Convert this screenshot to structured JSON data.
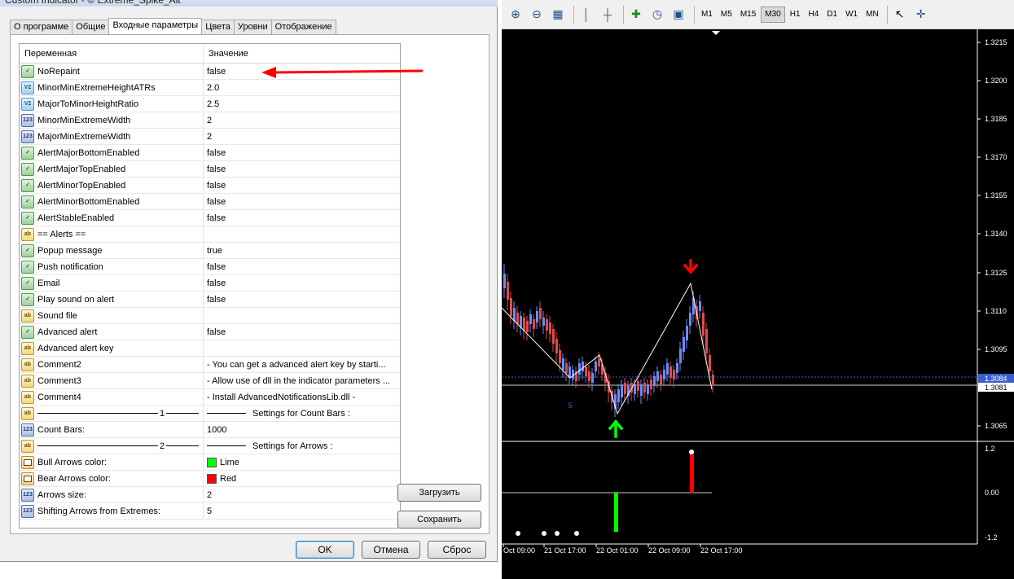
{
  "window": {
    "title": "Custom Indicator - © Extreme_Spike_Alt"
  },
  "tabs": [
    "О программе",
    "Общие",
    "Входные параметры",
    "Цвета",
    "Уровни",
    "Отображение"
  ],
  "grid": {
    "headers": {
      "variable": "Переменная",
      "value": "Значение"
    },
    "rows": [
      {
        "type": "bool",
        "icon": "bool-icon",
        "name": "NoRepaint",
        "value": "false"
      },
      {
        "type": "dbl",
        "icon": "double-icon",
        "name": "MinorMinExtremeHeightATRs",
        "value": "2.0"
      },
      {
        "type": "dbl",
        "icon": "double-icon",
        "name": "MajorToMinorHeightRatio",
        "value": "2.5"
      },
      {
        "type": "int",
        "icon": "integer-icon",
        "name": "MinorMinExtremeWidth",
        "value": "2"
      },
      {
        "type": "int",
        "icon": "integer-icon",
        "name": "MajorMinExtremeWidth",
        "value": "2"
      },
      {
        "type": "bool",
        "icon": "bool-icon",
        "name": "AlertMajorBottomEnabled",
        "value": "false"
      },
      {
        "type": "bool",
        "icon": "bool-icon",
        "name": "AlertMajorTopEnabled",
        "value": "false"
      },
      {
        "type": "bool",
        "icon": "bool-icon",
        "name": "AlertMinorTopEnabled",
        "value": "false"
      },
      {
        "type": "bool",
        "icon": "bool-icon",
        "name": "AlertMinorBottomEnabled",
        "value": "false"
      },
      {
        "type": "bool",
        "icon": "bool-icon",
        "name": "AlertStableEnabled",
        "value": "false"
      },
      {
        "type": "str",
        "icon": "string-icon",
        "name": "== Alerts ==",
        "value": ""
      },
      {
        "type": "bool",
        "icon": "bool-icon",
        "name": "Popup message",
        "value": "true"
      },
      {
        "type": "bool",
        "icon": "bool-icon",
        "name": "Push notification",
        "value": "false"
      },
      {
        "type": "bool",
        "icon": "bool-icon",
        "name": "Email",
        "value": "false"
      },
      {
        "type": "bool",
        "icon": "bool-icon",
        "name": "Play sound on alert",
        "value": "false"
      },
      {
        "type": "str",
        "icon": "string-icon",
        "name": "Sound file",
        "value": ""
      },
      {
        "type": "bool",
        "icon": "bool-icon",
        "name": "Advanced alert",
        "value": "false"
      },
      {
        "type": "str",
        "icon": "string-icon",
        "name": "Advanced alert key",
        "value": ""
      },
      {
        "type": "str",
        "icon": "string-icon",
        "name": "Comment2",
        "value": "- You can get a advanced alert key by starti..."
      },
      {
        "type": "str",
        "icon": "string-icon",
        "name": "Comment3",
        "value": "- Allow use of dll in the indicator parameters ..."
      },
      {
        "type": "str",
        "icon": "string-icon",
        "name": "Comment4",
        "value": "- Install AdvancedNotificationsLib.dll -"
      },
      {
        "type": "sep",
        "icon": "string-icon",
        "name": "1",
        "value": "Settings for  Count Bars :"
      },
      {
        "type": "int",
        "icon": "integer-icon",
        "name": "Count Bars:",
        "value": "1000"
      },
      {
        "type": "sep",
        "icon": "string-icon",
        "name": "2",
        "value": "Settings for  Arrows :"
      },
      {
        "type": "col",
        "icon": "color-icon",
        "name": "Bull Arrows color:",
        "value": "Lime",
        "color": "#00ff00"
      },
      {
        "type": "col",
        "icon": "color-icon",
        "name": "Bear Arrows color:",
        "value": "Red",
        "color": "#ff0000"
      },
      {
        "type": "int",
        "icon": "integer-icon",
        "name": "Arrows size:",
        "value": "2"
      },
      {
        "type": "int",
        "icon": "integer-icon",
        "name": "Shifting Arrows from Extremes:",
        "value": "5"
      }
    ]
  },
  "buttons": {
    "load": "Загрузить",
    "save": "Сохранить",
    "ok": "OK",
    "cancel": "Отмена",
    "reset": "Сброс"
  },
  "toolbar": {
    "timeframes": [
      "M1",
      "M5",
      "M15",
      "M30",
      "H1",
      "H4",
      "D1",
      "W1",
      "MN"
    ],
    "selected": "M30"
  },
  "chart": {
    "price_labels": [
      "1.3215",
      "1.3200",
      "1.3185",
      "1.3170",
      "1.3155",
      "1.3140",
      "1.3125",
      "1.3110",
      "1.3095",
      "1.3065"
    ],
    "bid_label": "1.3084",
    "ask_label": "1.3081",
    "indicator_labels": [
      "1.2",
      "0.00",
      "-1.2"
    ],
    "time_labels": [
      "Oct 09:00",
      "21 Oct 17:00",
      "22 Oct 01:00",
      "22 Oct 09:00",
      "22 Oct 17:00"
    ],
    "marker_label": "5",
    "colors": {
      "bull": "#00ff00",
      "bear": "#ff0000",
      "annotation": "#ff0000"
    }
  }
}
